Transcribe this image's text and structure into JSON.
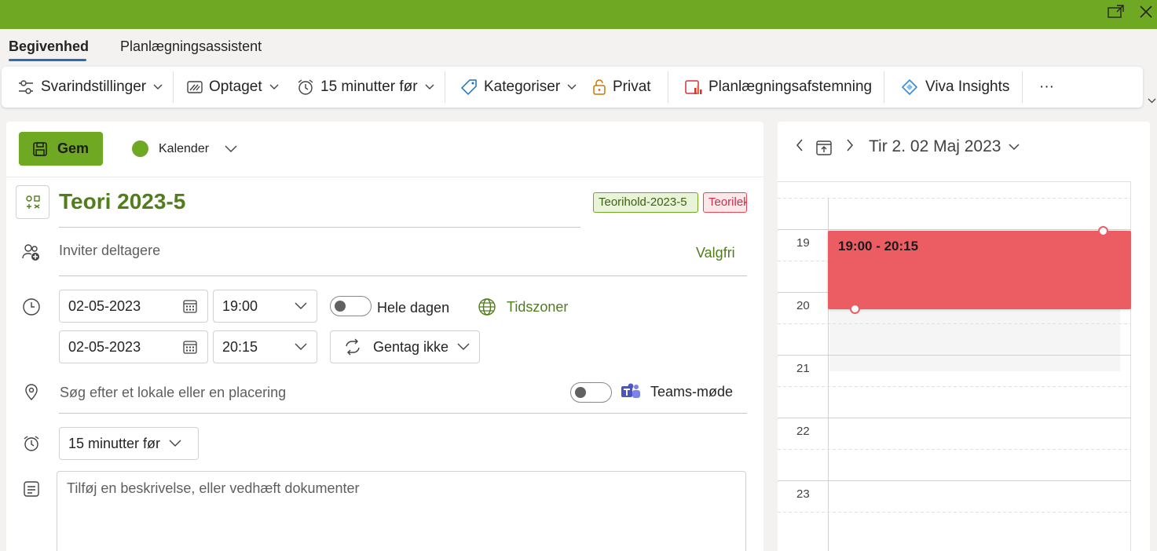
{
  "window": {
    "accent_color": "#6fa822",
    "popout_icon": "popout-icon",
    "close_icon": "close-icon"
  },
  "tabs": [
    {
      "label": "Begivenhed",
      "active": true
    },
    {
      "label": "Planlægningsassistent",
      "active": false
    }
  ],
  "ribbon": {
    "response_options": "Svarindstillinger",
    "show_as": "Optaget",
    "reminder": "15 minutter før",
    "categorize": "Kategoriser",
    "private": "Privat",
    "scheduling_poll": "Planlægningsafstemning",
    "viva_insights": "Viva Insights",
    "more": "···"
  },
  "toolbar": {
    "save_label": "Gem",
    "calendar_label": "Kalender",
    "calendar_color": "#6fa822"
  },
  "event": {
    "title": "Teori 2023-5",
    "categories": [
      {
        "label": "Teorihold-2023-5",
        "color": "#6fa822"
      },
      {
        "label": "Teorilek",
        "color": "#e74856"
      }
    ],
    "invite_placeholder": "Inviter deltagere",
    "optional_label": "Valgfri",
    "start_date": "02-05-2023",
    "start_time": "19:00",
    "end_date": "02-05-2023",
    "end_time": "20:15",
    "all_day_label": "Hele dagen",
    "all_day_on": false,
    "timezones_label": "Tidszoner",
    "repeat_label": "Gentag ikke",
    "location_placeholder": "Søg efter et lokale eller en placering",
    "teams_label": "Teams-møde",
    "teams_on": false,
    "reminder_value": "15 minutter før",
    "description_placeholder": "Tilføj en beskrivelse, eller vedhæft dokumenter"
  },
  "calendar": {
    "date_label": "Tir 2. 02 Maj 2023",
    "hours": [
      "19",
      "20",
      "21",
      "22",
      "23"
    ],
    "event_time": "19:00 - 20:15",
    "event_color": "#eb5d62"
  }
}
